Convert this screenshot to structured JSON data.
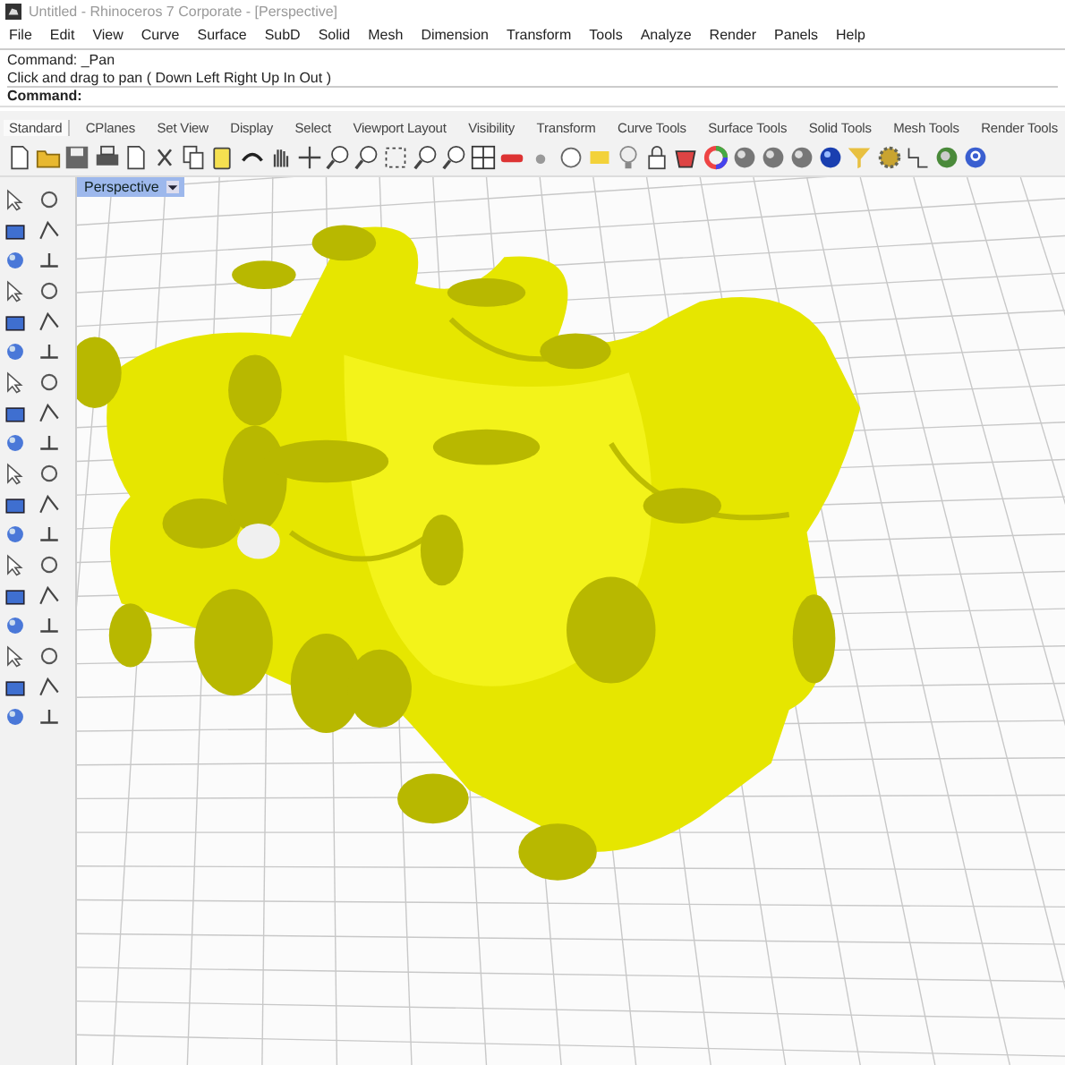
{
  "window": {
    "title": "Untitled - Rhinoceros 7 Corporate - [Perspective]"
  },
  "menu": [
    "File",
    "Edit",
    "View",
    "Curve",
    "Surface",
    "SubD",
    "Solid",
    "Mesh",
    "Dimension",
    "Transform",
    "Tools",
    "Analyze",
    "Render",
    "Panels",
    "Help"
  ],
  "command_history": [
    "Command: _Pan",
    "Click and drag to pan ( Down  Left  Right  Up  In  Out )"
  ],
  "command_prompt": "Command:",
  "toolbar_tabs": [
    {
      "label": "Standard",
      "selected": true
    },
    {
      "label": "CPlanes",
      "selected": false
    },
    {
      "label": "Set View",
      "selected": false
    },
    {
      "label": "Display",
      "selected": false
    },
    {
      "label": "Select",
      "selected": false
    },
    {
      "label": "Viewport Layout",
      "selected": false
    },
    {
      "label": "Visibility",
      "selected": false
    },
    {
      "label": "Transform",
      "selected": false
    },
    {
      "label": "Curve Tools",
      "selected": false
    },
    {
      "label": "Surface Tools",
      "selected": false
    },
    {
      "label": "Solid Tools",
      "selected": false
    },
    {
      "label": "Mesh Tools",
      "selected": false
    },
    {
      "label": "Render Tools",
      "selected": false
    }
  ],
  "viewport": {
    "title": "Perspective"
  }
}
